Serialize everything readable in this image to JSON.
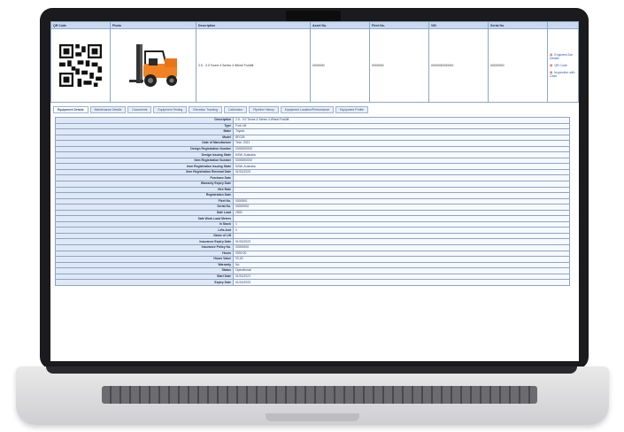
{
  "header": {
    "columns": [
      "QR Code",
      "Photo",
      "Description",
      "Asset No.",
      "Fleet No.",
      "VIN",
      "Serial No.",
      ""
    ],
    "description": "2.5 - 3.0 Tonne 4 Series 4 Wheel Forklift",
    "asset_no": "0000000",
    "fleet_no": "0000000",
    "vin": "0000000000000",
    "serial_no": "00000000",
    "links": [
      {
        "label": "Engineer/Job Details",
        "icon": "document-icon"
      },
      {
        "label": "QR Code",
        "icon": "document-icon"
      },
      {
        "label": "Inspection with Case",
        "icon": "document-icon"
      }
    ]
  },
  "tabs": [
    "Equipment Details",
    "Maintenance Details",
    "Documents",
    "Equipment Testing",
    "Elevation Tracking",
    "Calibration",
    "Pipeline History",
    "Equipment Location/Performance",
    "Equipment Profile"
  ],
  "details": [
    {
      "k": "Description",
      "v": "2.5 - 3.0 Tonne 4 Series 4 Wheel Forklift"
    },
    {
      "k": "Type",
      "v": "Fork Lift"
    },
    {
      "k": "Make",
      "v": "Toyota"
    },
    {
      "k": "Model",
      "v": "8FG25"
    },
    {
      "k": "Date of Manufacture",
      "v": "Year: 2021"
    },
    {
      "k": "Design Registration Number",
      "v": "0000000000"
    },
    {
      "k": "Design Issuing State",
      "v": "NSW, Australia"
    },
    {
      "k": "Item Registration Number",
      "v": "0000000000"
    },
    {
      "k": "Item Registration Issuing State",
      "v": "NSW, Australia"
    },
    {
      "k": "Item Registration Renewal Date",
      "v": "01/01/2023"
    },
    {
      "k": "Purchase Date",
      "v": ""
    },
    {
      "k": "Warranty Expiry Date",
      "v": ""
    },
    {
      "k": "Hire Rate",
      "v": ""
    },
    {
      "k": "Registration Date",
      "v": ""
    },
    {
      "k": "Fleet No.",
      "v": "0000000"
    },
    {
      "k": "Serial No.",
      "v": "00000000"
    },
    {
      "k": "Safe Load",
      "v": "2500"
    },
    {
      "k": "Safe Work Load Meters",
      "v": ""
    },
    {
      "k": "In Stock",
      "v": "1"
    },
    {
      "k": "Lifts Amt",
      "v": "0"
    },
    {
      "k": "Name of Lift",
      "v": ""
    },
    {
      "k": "Insurance Expiry Date",
      "v": "01/01/2023"
    },
    {
      "k": "Insurance Policy No.",
      "v": "00000000"
    },
    {
      "k": "Hours",
      "v": "0000.00"
    },
    {
      "k": "Hours Value",
      "v": "00.00"
    },
    {
      "k": "Warranty",
      "v": "No"
    },
    {
      "k": "Status",
      "v": "Operational"
    },
    {
      "k": "Start Date",
      "v": "01/01/2021"
    },
    {
      "k": "Expiry Date",
      "v": "01/01/2023"
    }
  ]
}
